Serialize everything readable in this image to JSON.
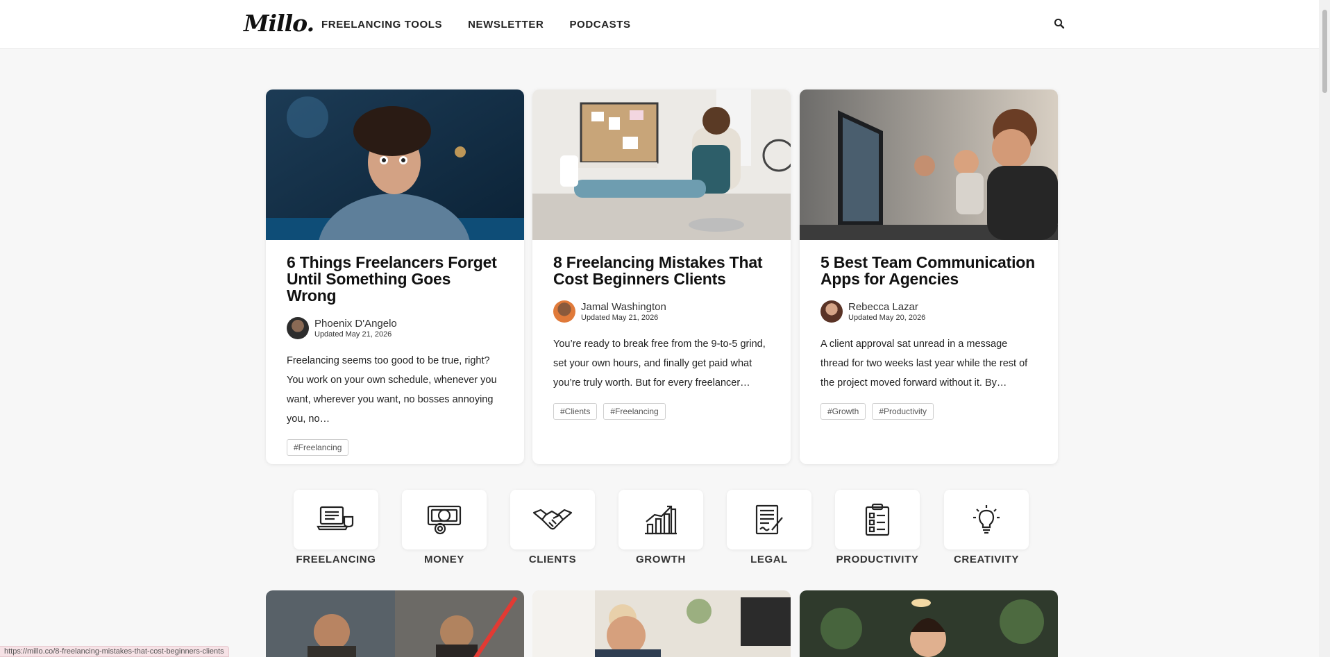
{
  "header": {
    "logo": "Millo.",
    "nav": [
      "FREELANCING TOOLS",
      "NEWSLETTER",
      "PODCASTS"
    ],
    "search_icon": "search-icon"
  },
  "articles": [
    {
      "title": "6 Things Freelancers Forget Until Something Goes Wrong",
      "author": "Phoenix D'Angelo",
      "date": "Updated May 21, 2026",
      "excerpt": "Freelancing seems too good to be true, right? You work on your own schedule, whenever you want, wherever you want, no bosses annoying you, no…",
      "tags": [
        "#Freelancing"
      ]
    },
    {
      "title": "8 Freelancing Mistakes That Cost Beginners Clients",
      "author": "Jamal Washington",
      "date": "Updated May 21, 2026",
      "excerpt": "You’re ready to break free from the 9-to-5 grind, set your own hours, and finally get paid what you’re truly worth. But for every freelancer…",
      "tags": [
        "#Clients",
        "#Freelancing"
      ]
    },
    {
      "title": "5 Best Team Communication Apps for Agencies",
      "author": "Rebecca Lazar",
      "date": "Updated May 20, 2026",
      "excerpt": "A client approval sat unread in a message thread for two weeks last year while the rest of the project moved forward without it. By…",
      "tags": [
        "#Growth",
        "#Productivity"
      ]
    }
  ],
  "categories": [
    {
      "label": "FREELANCING",
      "icon": "laptop-coffee-icon"
    },
    {
      "label": "MONEY",
      "icon": "money-coins-icon"
    },
    {
      "label": "CLIENTS",
      "icon": "handshake-icon"
    },
    {
      "label": "GROWTH",
      "icon": "growth-chart-icon"
    },
    {
      "label": "LEGAL",
      "icon": "contract-icon"
    },
    {
      "label": "PRODUCTIVITY",
      "icon": "checklist-icon"
    },
    {
      "label": "CREATIVITY",
      "icon": "lightbulb-icon"
    }
  ],
  "status_bar": "https://millo.co/8-freelancing-mistakes-that-cost-beginners-clients"
}
